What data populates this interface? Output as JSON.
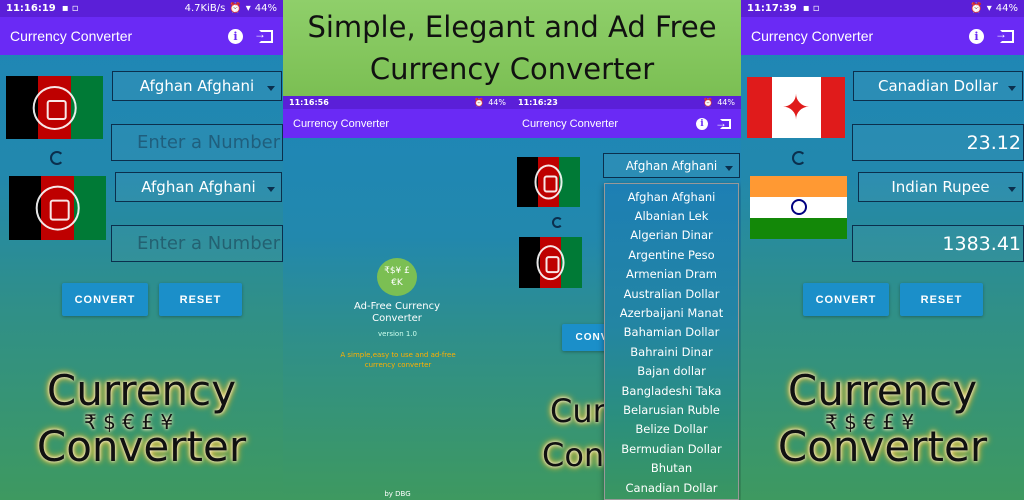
{
  "banner": {
    "line1": "Simple, Elegant and Ad Free",
    "line2": "Currency Converter"
  },
  "left": {
    "status": {
      "time": "11:16:19",
      "speed": "4.7KiB/s",
      "battery": "44%"
    },
    "appbar_title": "Currency Converter",
    "from_currency": "Afghan Afghani",
    "from_placeholder": "Enter a Number",
    "to_currency": "Afghan Afghani",
    "to_placeholder": "Enter a Number",
    "convert_label": "CONVERT",
    "reset_label": "RESET",
    "logo_line1": "Currency",
    "logo_symbols": "₹ $ € £ ¥",
    "logo_line2": "Converter"
  },
  "middle": {
    "splash_status": {
      "time": "11:16:56",
      "battery": "44%"
    },
    "dropdown_status": {
      "time": "11:16:23",
      "battery": "44%"
    },
    "appbar_title": "Currency Converter",
    "appbar_title_2": "Currency Converter",
    "splash_icon_symbols": "₹$¥ £€K",
    "splash_title": "Ad-Free Currency Converter",
    "splash_version": "version 1.0",
    "splash_desc": "A simple,easy to use and ad-free currency converter",
    "splash_by": "by DBG",
    "selected_currency": "Afghan Afghani",
    "convert_partial": "CONV",
    "logo_partial_1": "Cur",
    "logo_partial_2": "Con",
    "dropdown_items": [
      "Afghan Afghani",
      "Albanian Lek",
      "Algerian Dinar",
      "Argentine Peso",
      "Armenian Dram",
      "Australian Dollar",
      "Azerbaijani Manat",
      "Bahamian Dollar",
      "Bahraini Dinar",
      "Bajan dollar",
      "Bangladeshi Taka",
      "Belarusian Ruble",
      "Belize Dollar",
      "Bermudian Dollar",
      "Bhutan",
      "Canadian Dollar"
    ]
  },
  "right": {
    "status": {
      "time": "11:17:39",
      "battery": "44%"
    },
    "appbar_title": "Currency Converter",
    "from_currency": "Canadian Dollar",
    "from_value": "23.12",
    "to_currency": "Indian Rupee",
    "to_value": "1383.41",
    "convert_label": "CONVERT",
    "reset_label": "RESET",
    "logo_line1": "Currency",
    "logo_symbols": "₹ $ € £ ¥",
    "logo_line2": "Converter"
  },
  "colors": {
    "appbar": "#6a2af5",
    "statusbar": "#5b1fd8",
    "button": "#1b8fc9",
    "banner": "#8fcf6a"
  }
}
